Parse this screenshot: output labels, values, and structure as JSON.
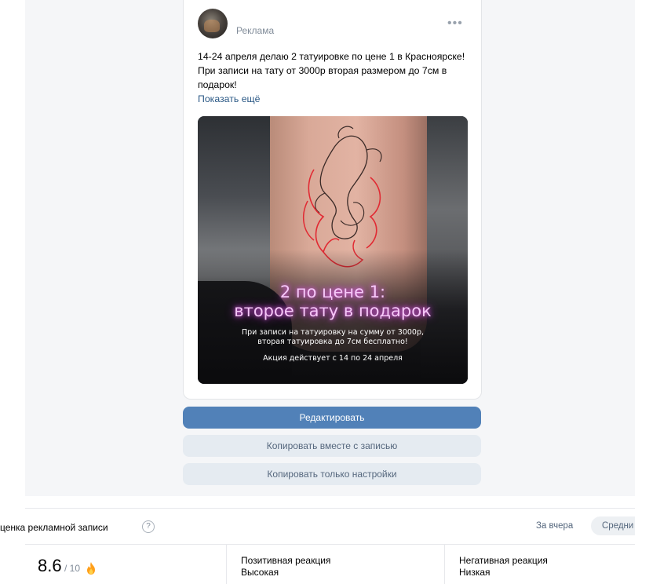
{
  "post": {
    "ad_label": "Реклама",
    "more_icon": "more-horizontal-icon",
    "text_lines": [
      "14-24 апреля делаю 2 татуировке по цене 1 в Красноярске!",
      "При записи на тату от 3000р вторая размером до 7см в",
      "подарок!"
    ],
    "show_more": "Показать ещё",
    "image": {
      "headline_1": "2 по цене 1:",
      "headline_2": "второе тату в подарок",
      "sub_1": "При записи на татуировку на сумму от 3000р,",
      "sub_2": "вторая татуировка до 7см бесплатно!",
      "dates": "Акция действует с 14 по 24 апреля"
    }
  },
  "actions": {
    "edit": "Редактировать",
    "copy_with_post": "Копировать вместе с записью",
    "copy_settings": "Копировать только настройки"
  },
  "score": {
    "title": "ценка рекламной записи",
    "help": "?",
    "period": "За вчера",
    "avg_chip": "Средни",
    "value": "8.6",
    "max": "/ 10",
    "positive_label": "Позитивная реакция",
    "positive_value": "Высокая",
    "negative_label": "Негативная реакция",
    "negative_value": "Низкая"
  },
  "colors": {
    "primary_button": "#5181b8",
    "secondary_button": "#e5ebf1",
    "link": "#2a5885",
    "neon_pink": "#f6c7f8"
  }
}
